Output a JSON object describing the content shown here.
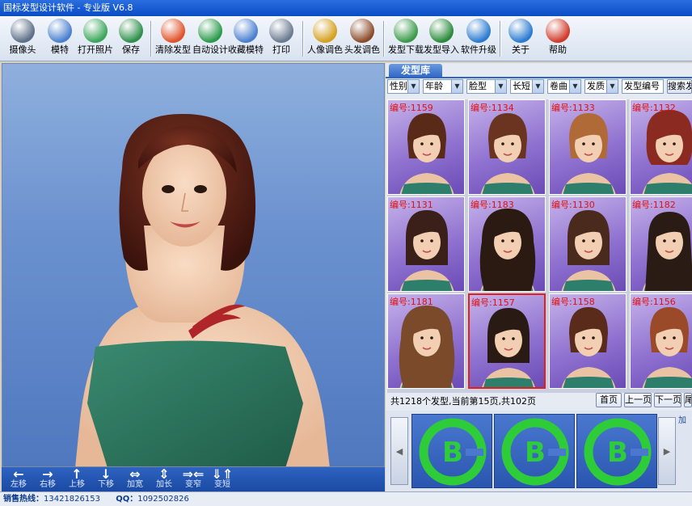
{
  "window": {
    "title": "国标发型设计软件 - 专业版 V6.8"
  },
  "toolbar": {
    "buttons": [
      {
        "label": "摄像头",
        "icon": "webcam-icon",
        "color": "#5b6f86"
      },
      {
        "label": "模特",
        "icon": "model-person-icon",
        "color": "#4a7fd0"
      },
      {
        "label": "打开照片",
        "icon": "open-folder-icon",
        "color": "#3aa65a"
      },
      {
        "label": "保存",
        "icon": "save-icon",
        "color": "#2e8f4a"
      },
      {
        "label": "清除发型",
        "icon": "clear-x-icon",
        "color": "#e0522a"
      },
      {
        "label": "自动设计",
        "icon": "auto-design-icon",
        "color": "#2a9a4a"
      },
      {
        "label": "收藏模特",
        "icon": "favorite-model-icon",
        "color": "#4a7fd0"
      },
      {
        "label": "打印",
        "icon": "printer-icon",
        "color": "#6a7a90"
      },
      {
        "label": "人像调色",
        "icon": "portrait-color-icon",
        "color": "#d4a020"
      },
      {
        "label": "头发调色",
        "icon": "hair-color-icon",
        "color": "#8a4a28"
      },
      {
        "label": "发型下载",
        "icon": "hair-download-icon",
        "color": "#3a9a4a"
      },
      {
        "label": "发型导入",
        "icon": "hair-import-icon",
        "color": "#2a8a3a"
      },
      {
        "label": "软件升级",
        "icon": "upgrade-globe-icon",
        "color": "#2a7ad0"
      },
      {
        "label": "关于",
        "icon": "about-info-icon",
        "color": "#2a7ad0"
      },
      {
        "label": "帮助",
        "icon": "help-question-icon",
        "color": "#d03a2a"
      }
    ]
  },
  "movebar": {
    "buttons": [
      {
        "label": "左移",
        "arrow": "←"
      },
      {
        "label": "右移",
        "arrow": "→"
      },
      {
        "label": "上移",
        "arrow": "↑"
      },
      {
        "label": "下移",
        "arrow": "↓"
      },
      {
        "label": "加宽",
        "arrow": "⇔"
      },
      {
        "label": "加长",
        "arrow": "⇕"
      },
      {
        "label": "变窄",
        "arrow": "⇒⇐"
      },
      {
        "label": "变短",
        "arrow": "⇓⇑"
      }
    ]
  },
  "status": {
    "hotline_label": "销售热线：",
    "hotline": "13421826153",
    "qq_label": "QQ：",
    "qq": "1092502826"
  },
  "library": {
    "tab": "发型库",
    "filters": {
      "gender": "性别",
      "age": "年龄",
      "face": "脸型",
      "length": "长短",
      "curl": "卷曲",
      "texture": "发质",
      "code_input": "发型编号",
      "search_button": "搜索发型"
    },
    "cells": [
      {
        "code": "编号:1159",
        "hair": "#5a2a18",
        "len": "short"
      },
      {
        "code": "编号:1134",
        "hair": "#6a3420",
        "len": "short"
      },
      {
        "code": "编号:1133",
        "hair": "#b06a38",
        "len": "short"
      },
      {
        "code": "编号:1132",
        "hair": "#8a2a20",
        "len": "curly"
      },
      {
        "code": "编号:1131",
        "hair": "#3a2018",
        "len": "bob"
      },
      {
        "code": "编号:1183",
        "hair": "#2a1a12",
        "len": "longcurl"
      },
      {
        "code": "编号:1130",
        "hair": "#4a2a1c",
        "len": "bob"
      },
      {
        "code": "编号:1182",
        "hair": "#2a1c14",
        "len": "long"
      },
      {
        "code": "编号:1181",
        "hair": "#7a4a2a",
        "len": "longcurl"
      },
      {
        "code": "编号:1157",
        "hair": "#2a1a14",
        "len": "bob",
        "selected": true
      },
      {
        "code": "编号:1158",
        "hair": "#5a2a1a",
        "len": "short"
      },
      {
        "code": "编号:1156",
        "hair": "#9a4a28",
        "len": "short"
      }
    ],
    "page_info": "共1218个发型,当前第15页,共102页",
    "pager": {
      "first": "首页",
      "prev": "上一页",
      "next": "下一页",
      "last": "尾页"
    },
    "swatch_letter": "B",
    "swatch_extra": "加"
  }
}
